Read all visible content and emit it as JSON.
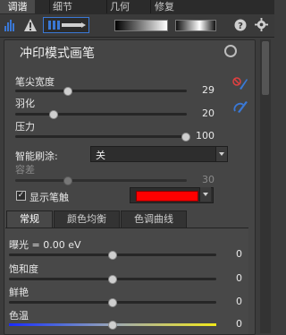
{
  "tabs": [
    {
      "label": "调谐",
      "active": true
    },
    {
      "label": "细节",
      "active": false
    },
    {
      "label": "几何",
      "active": false
    },
    {
      "label": "修复",
      "active": false
    }
  ],
  "toolbar": {
    "icons": [
      "histogram-icon",
      "warning-icon",
      "brush-tool-icon",
      "gradient-linear-icon",
      "gradient-radial-icon",
      "help-icon",
      "settings-icon"
    ]
  },
  "panel": {
    "title": "冲印模式画笔",
    "brush_size": {
      "label": "笔尖宽度",
      "value": "29",
      "fraction": 0.29
    },
    "feather": {
      "label": "羽化",
      "value": "20",
      "fraction": 0.2
    },
    "pressure": {
      "label": "压力",
      "value": "100",
      "fraction": 1.0
    },
    "smart_brush": {
      "label": "智能刷涂:",
      "value": "关"
    },
    "tolerance": {
      "label": "容差",
      "value": "30",
      "fraction": 0.3
    },
    "show_stroke": {
      "label": "显示笔触",
      "checked": true,
      "color": "#ff0000"
    }
  },
  "subtabs": [
    {
      "label": "常规",
      "active": true
    },
    {
      "label": "颜色均衡",
      "active": false
    },
    {
      "label": "色调曲线",
      "active": false
    }
  ],
  "adjustments": [
    {
      "label": "曝光 = 0.00 eV",
      "value": "0",
      "fraction": 0.5
    },
    {
      "label": "饱和度",
      "value": "0",
      "fraction": 0.5
    },
    {
      "label": "鲜艳",
      "value": "0",
      "fraction": 0.5
    },
    {
      "label": "色温",
      "value": "0",
      "fraction": 0.5
    }
  ],
  "colors": {
    "accent": "#3a78d6",
    "stroke": "#ff0000"
  }
}
